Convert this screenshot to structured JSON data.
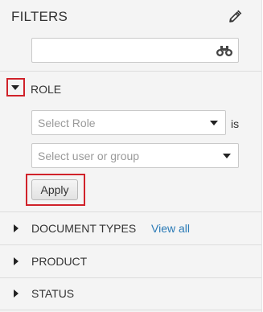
{
  "header": {
    "title": "FILTERS",
    "edit_icon": "pencil-icon"
  },
  "search": {
    "value": "",
    "placeholder": "",
    "icon": "binoculars-icon"
  },
  "role_section": {
    "label": "ROLE",
    "expanded": true,
    "toggle_icon": "triangle-down-icon",
    "role_select": {
      "placeholder": "Select Role"
    },
    "is_label": "is",
    "user_select": {
      "placeholder": "Select user or group"
    },
    "apply_label": "Apply"
  },
  "sections": [
    {
      "label": "DOCUMENT TYPES",
      "link": "View all",
      "expanded": false
    },
    {
      "label": "PRODUCT",
      "expanded": false
    },
    {
      "label": "STATUS",
      "expanded": false
    }
  ],
  "colors": {
    "panel_bg": "#f4f4f4",
    "highlight_border": "#d0222a",
    "link": "#2a7ab6",
    "placeholder": "#9a9a9a"
  }
}
